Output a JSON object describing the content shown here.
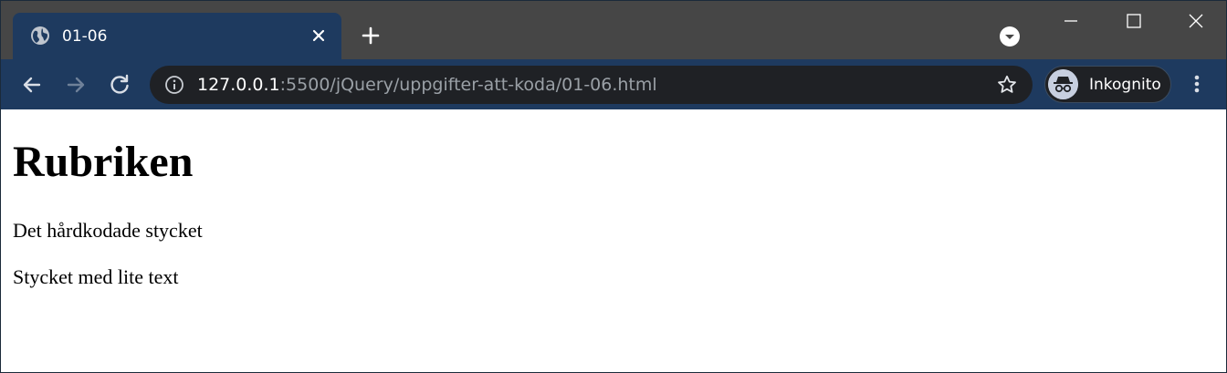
{
  "browser": {
    "tab": {
      "title": "01-06",
      "favicon": "globe-icon"
    },
    "omnibox": {
      "url_host": "127.0.0.1",
      "url_rest": ":5500/jQuery/uppgifter-att-koda/01-06.html"
    },
    "profile": {
      "label": "Inkognito"
    },
    "colors": {
      "tabstrip": "#464646",
      "toolbar": "#1e3a5f",
      "omnibox": "#1f2125",
      "url_dim": "#9aa0a6"
    }
  },
  "page": {
    "heading": "Rubriken",
    "paragraphs": [
      "Det hårdkodade stycket",
      "Stycket med lite text"
    ]
  }
}
